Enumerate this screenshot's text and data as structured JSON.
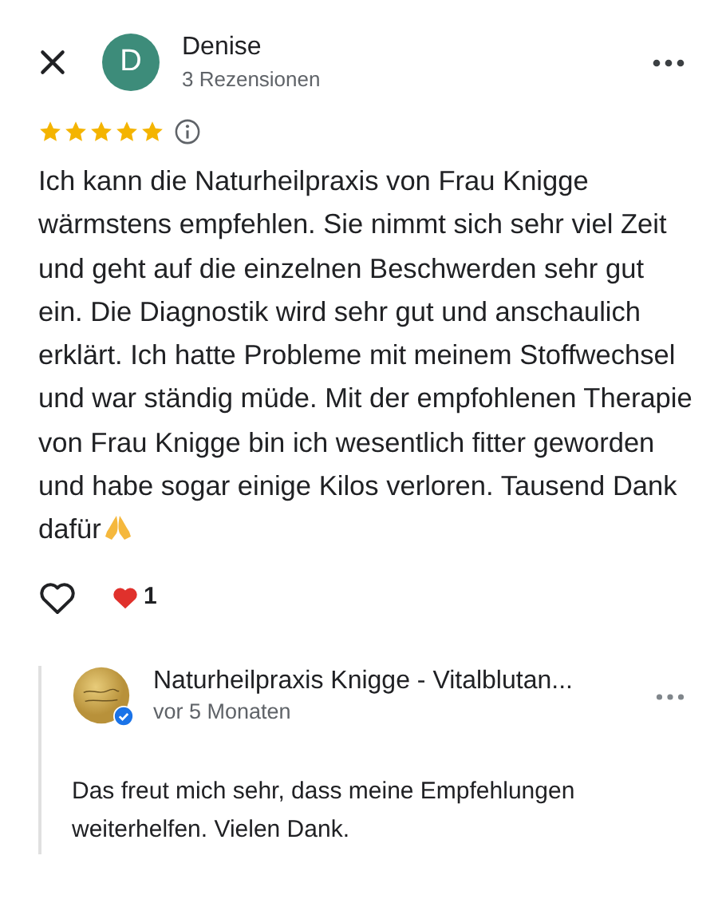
{
  "reviewer": {
    "initial": "D",
    "name": "Denise",
    "meta": "3 Rezensionen"
  },
  "review": {
    "stars": 5,
    "text": "Ich kann die Naturheilpraxis von Frau Knigge wärmstens empfehlen. Sie nimmt sich sehr viel Zeit und geht auf die einzelnen Beschwerden sehr gut ein. Die Diagnostik wird sehr gut und anschaulich erklärt. Ich hatte Probleme mit meinem Stoffwechsel und war ständig müde. Mit der empfohlenen Therapie von Frau Knigge bin ich wesentlich fitter geworden und habe sogar einige Kilos verloren. Tausend Dank dafür"
  },
  "reactions": {
    "liked": false,
    "count": "1"
  },
  "reply": {
    "name": "Naturheilpraxis Knigge - Vitalblutan...",
    "verified": true,
    "time": "vor 5 Monaten",
    "text": "Das freut mich sehr, dass meine Empfehlungen weiterhelfen. Vielen Dank."
  }
}
